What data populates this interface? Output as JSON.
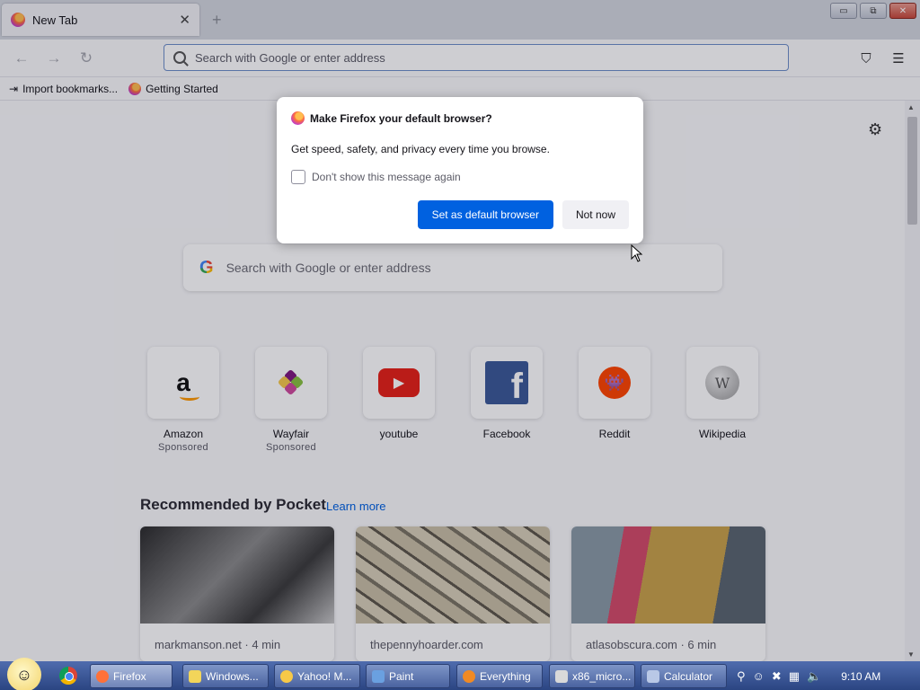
{
  "window": {
    "tab_title": "New Tab",
    "tab_close": "✕",
    "new_tab": "+",
    "controls": {
      "minimize": "▭",
      "restore": "⧉",
      "close": "✕"
    }
  },
  "navbar": {
    "back_icon": "←",
    "forward_icon": "→",
    "reload_icon": "↻",
    "url_placeholder": "Search with Google or enter address",
    "pocket_icon": "⛉",
    "menu_icon": "☰"
  },
  "bookmarks": [
    {
      "label": "Import bookmarks...",
      "icon": "import-icon"
    },
    {
      "label": "Getting Started",
      "icon": "firefox-icon"
    }
  ],
  "newtab": {
    "settings_icon": "⚙",
    "search_placeholder": "Search with Google or enter address",
    "google_glyph": "G",
    "top_sites": [
      {
        "label": "Amazon",
        "sub": "Sponsored",
        "icon": "amazon-icon",
        "glyph": "a"
      },
      {
        "label": "Wayfair",
        "sub": "Sponsored",
        "icon": "wayfair-icon"
      },
      {
        "label": "youtube",
        "sub": "",
        "icon": "youtube-icon",
        "glyph": "▶"
      },
      {
        "label": "Facebook",
        "sub": "",
        "icon": "facebook-icon",
        "glyph": "f"
      },
      {
        "label": "Reddit",
        "sub": "",
        "icon": "reddit-icon",
        "glyph": "👾"
      },
      {
        "label": "Wikipedia",
        "sub": "",
        "icon": "wikipedia-icon",
        "glyph": "W"
      }
    ],
    "pocket": {
      "title": "Recommended by Pocket",
      "learn_more": "Learn more",
      "cards": [
        {
          "source": "markmanson.net · 4 min"
        },
        {
          "source": "thepennyhoarder.com"
        },
        {
          "source": "atlasobscura.com · 6 min"
        }
      ]
    }
  },
  "dialog": {
    "title": "Make Firefox your default browser?",
    "body": "Get speed, safety, and privacy every time you browse.",
    "checkbox_label": "Don't show this message again",
    "checkbox_checked": false,
    "primary_button": "Set as default browser",
    "secondary_button": "Not now"
  },
  "taskbar": {
    "tasks": [
      {
        "label": "Firefox",
        "active": true,
        "color": "#ff7139"
      },
      {
        "label": "Windows...",
        "active": false,
        "color": "#f2d55a"
      },
      {
        "label": "Yahoo! M...",
        "active": false,
        "color": "#f7c948"
      },
      {
        "label": "Paint",
        "active": false,
        "color": "#6aa0e0"
      },
      {
        "label": "Everything",
        "active": false,
        "color": "#f08a24"
      },
      {
        "label": "x86_micro...",
        "active": false,
        "color": "#d9d9d9"
      },
      {
        "label": "Calculator",
        "active": false,
        "color": "#b9c8e6"
      }
    ],
    "clock": "9:10 AM"
  },
  "colors": {
    "accent": "#0061e0",
    "youtube": "#e62117",
    "facebook": "#3b5998",
    "reddit": "#ff4500",
    "amazon_smile": "#ff9900"
  }
}
